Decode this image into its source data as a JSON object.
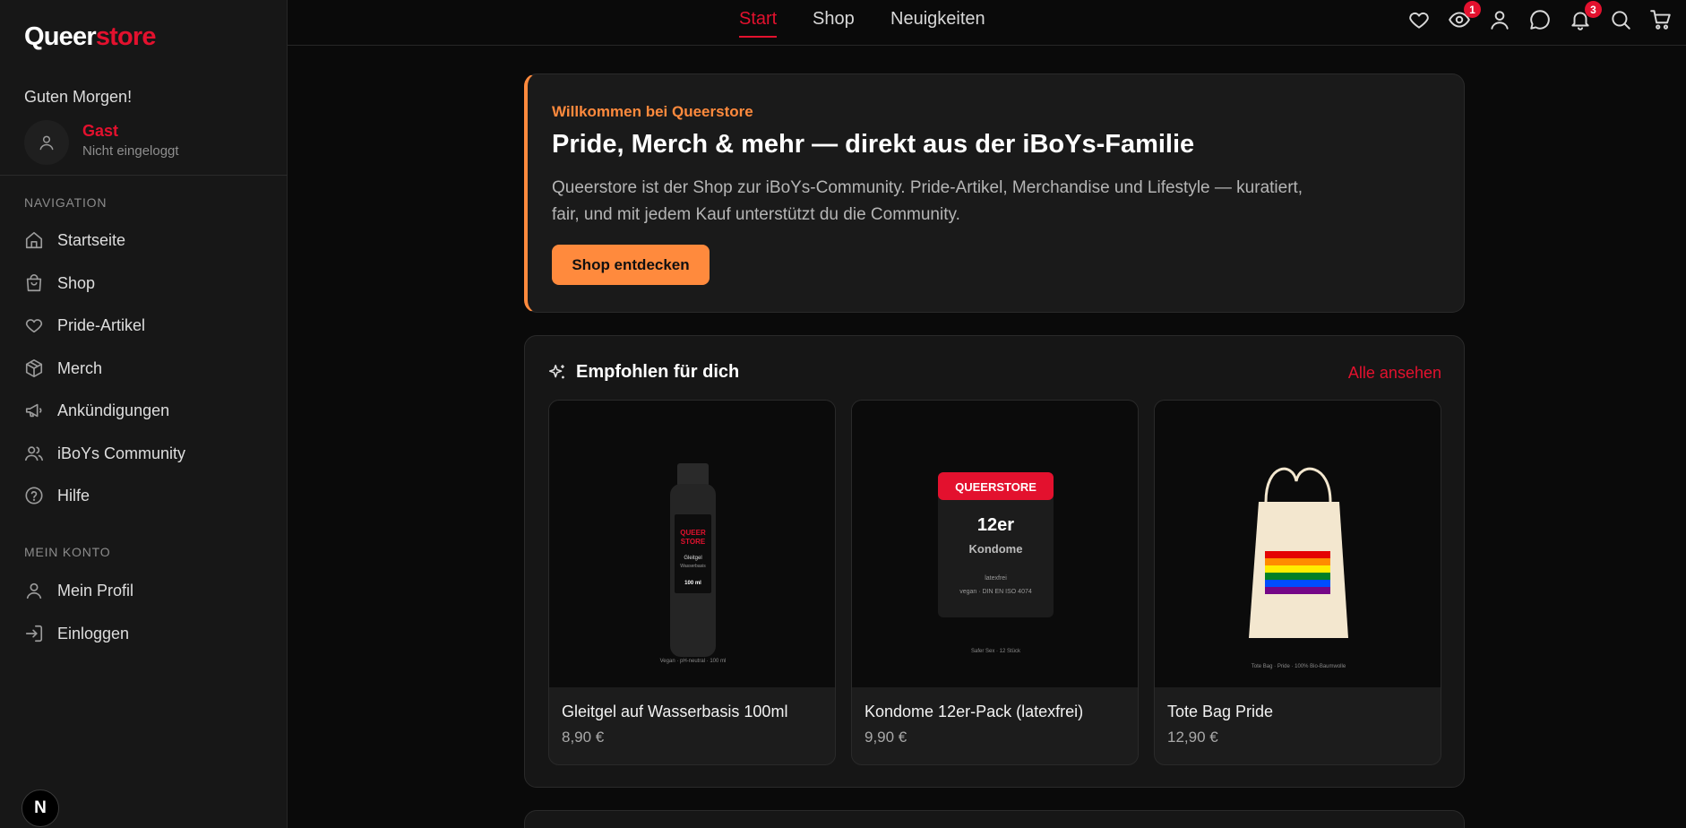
{
  "brand": {
    "part1": "Queer",
    "part2": "store"
  },
  "user": {
    "greeting": "Guten Morgen!",
    "name": "Gast",
    "status": "Nicht eingeloggt"
  },
  "sidebar": {
    "nav_label": "NAVIGATION",
    "nav_items": [
      {
        "label": "Startseite",
        "icon": "home-icon"
      },
      {
        "label": "Shop",
        "icon": "shopping-bag-icon"
      },
      {
        "label": "Pride-Artikel",
        "icon": "heart-icon"
      },
      {
        "label": "Merch",
        "icon": "package-icon"
      },
      {
        "label": "Ankündigungen",
        "icon": "megaphone-icon"
      },
      {
        "label": "iBoYs Community",
        "icon": "users-icon"
      },
      {
        "label": "Hilfe",
        "icon": "help-circle-icon"
      }
    ],
    "account_label": "MEIN KONTO",
    "account_items": [
      {
        "label": "Mein Profil",
        "icon": "user-icon"
      },
      {
        "label": "Einloggen",
        "icon": "login-icon"
      }
    ],
    "dev_badge": "N"
  },
  "topnav": {
    "links": [
      "Start",
      "Shop",
      "Neuigkeiten"
    ],
    "active": "Start",
    "icons": [
      {
        "name": "heart-icon"
      },
      {
        "name": "eye-icon",
        "badge": "1"
      },
      {
        "name": "user-icon"
      },
      {
        "name": "chat-icon"
      },
      {
        "name": "bell-icon",
        "badge": "3"
      },
      {
        "name": "search-icon"
      },
      {
        "name": "cart-icon"
      }
    ]
  },
  "hero": {
    "kicker": "Willkommen bei Queerstore",
    "title": "Pride, Merch & mehr — direkt aus der iBoYs-Familie",
    "text": "Queerstore ist der Shop zur iBoYs-Community. Pride-Artikel, Merchandise und Lifestyle — kuratiert, fair, und mit jedem Kauf unterstützt du die Community.",
    "button": "Shop entdecken"
  },
  "recommended": {
    "title": "Empfohlen für dich",
    "all_link": "Alle ansehen",
    "products": [
      {
        "name": "Gleitgel auf Wasserbasis 100ml",
        "price": "8,90 €",
        "img": {
          "brand1": "QUEER",
          "brand2": "STORE",
          "line1": "Gleitgel",
          "line2": "Wasserbasis",
          "line3": "100 ml",
          "caption": "Vegan · pH-neutral · 100 ml"
        }
      },
      {
        "name": "Kondome 12er-Pack (latexfrei)",
        "price": "9,90 €",
        "img": {
          "brand": "QUEERSTORE",
          "count": "12er",
          "type": "Kondome",
          "line1": "latexfrei",
          "line2": "vegan · DIN EN ISO 4074",
          "caption": "Safer Sex · 12 Stück"
        }
      },
      {
        "name": "Tote Bag Pride",
        "price": "12,90 €",
        "img": {
          "caption": "Tote Bag · Pride · 100% Bio-Baumwolle"
        }
      }
    ]
  },
  "colors": {
    "accent": "#e3112e",
    "orange": "#ff8a3d",
    "background": "#0a0a0a",
    "panel": "#171717"
  }
}
